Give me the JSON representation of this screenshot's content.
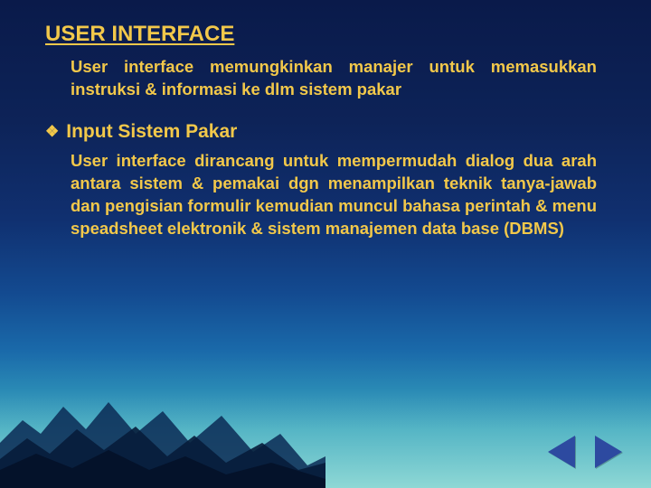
{
  "title": "USER INTERFACE",
  "para1": "User interface memungkinkan manajer untuk memasukkan instruksi & informasi ke dlm sistem pakar",
  "subhead": "Input Sistem Pakar",
  "para2": "User interface dirancang untuk mempermudah dialog dua arah antara sistem & pemakai dgn menampilkan teknik tanya-jawab dan pengisian formulir kemudian muncul bahasa perintah & menu speadsheet elektronik & sistem manajemen data base (DBMS)",
  "nav": {
    "prev_label": "Previous slide",
    "next_label": "Next slide"
  }
}
